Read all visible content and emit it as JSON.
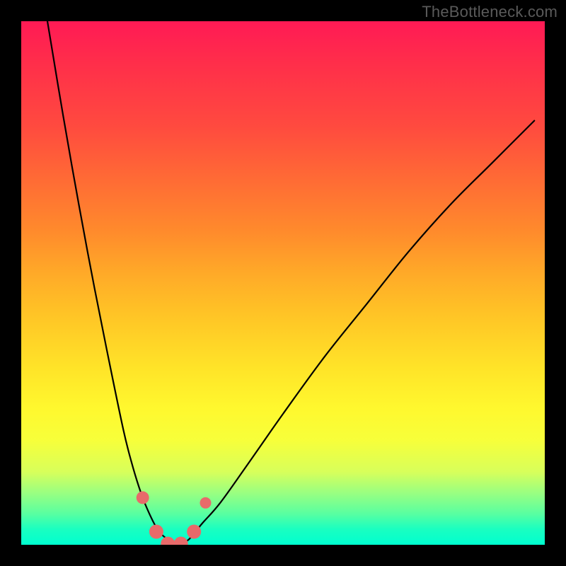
{
  "watermark": "TheBottleneck.com",
  "colors": {
    "frame": "#000000",
    "curve": "#000000",
    "marker_fill": "#e86a6a",
    "marker_stroke": "#d24f4f",
    "gradient_stops": [
      "#ff1a55",
      "#ff2e4a",
      "#ff4a3f",
      "#ff6a35",
      "#ff8a2c",
      "#ffa928",
      "#ffc426",
      "#ffe328",
      "#fff82e",
      "#f7ff3a",
      "#d8ff5a",
      "#9bff80",
      "#5affa0",
      "#1affc0",
      "#00ffd0"
    ]
  },
  "chart_data": {
    "type": "line",
    "title": "",
    "xlabel": "",
    "ylabel": "",
    "xlim": [
      0,
      1
    ],
    "ylim": [
      0,
      1
    ],
    "series": [
      {
        "name": "left-curve",
        "x": [
          0.05,
          0.08,
          0.11,
          0.14,
          0.17,
          0.195,
          0.21,
          0.225,
          0.24,
          0.26,
          0.28,
          0.3
        ],
        "y": [
          0.0,
          0.18,
          0.35,
          0.51,
          0.66,
          0.78,
          0.84,
          0.89,
          0.93,
          0.97,
          0.99,
          1.0
        ]
      },
      {
        "name": "right-curve",
        "x": [
          0.3,
          0.32,
          0.345,
          0.38,
          0.43,
          0.5,
          0.58,
          0.66,
          0.74,
          0.82,
          0.9,
          0.98
        ],
        "y": [
          1.0,
          0.99,
          0.96,
          0.92,
          0.85,
          0.75,
          0.64,
          0.54,
          0.44,
          0.35,
          0.27,
          0.19
        ]
      },
      {
        "name": "markers",
        "x": [
          0.232,
          0.258,
          0.28,
          0.305,
          0.33,
          0.352
        ],
        "y": [
          0.91,
          0.975,
          0.998,
          0.998,
          0.975,
          0.92
        ],
        "r": [
          9,
          10,
          10,
          10,
          10,
          8
        ]
      }
    ]
  }
}
